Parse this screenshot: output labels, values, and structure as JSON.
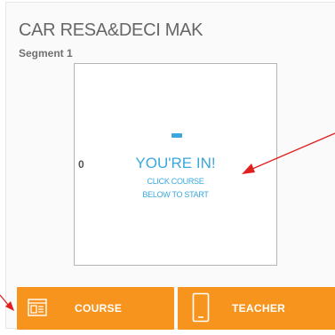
{
  "course": {
    "title": "CAR RESA&DECI MAK",
    "segment_label": "Segment 1"
  },
  "panel": {
    "counter": "0",
    "headline": "YOU'RE IN!",
    "instruction_line1": "CLICK COURSE",
    "instruction_line2": "BELOW TO START"
  },
  "buttons": {
    "course_label": "COURSE",
    "teacher_label": "TEACHER"
  },
  "colors": {
    "accent_blue": "#3aa7dd",
    "button_orange": "#f7941e",
    "annotation_arrow": "#e02020"
  },
  "icons": {
    "course": "course-screen-icon",
    "teacher": "mobile-phone-icon"
  }
}
